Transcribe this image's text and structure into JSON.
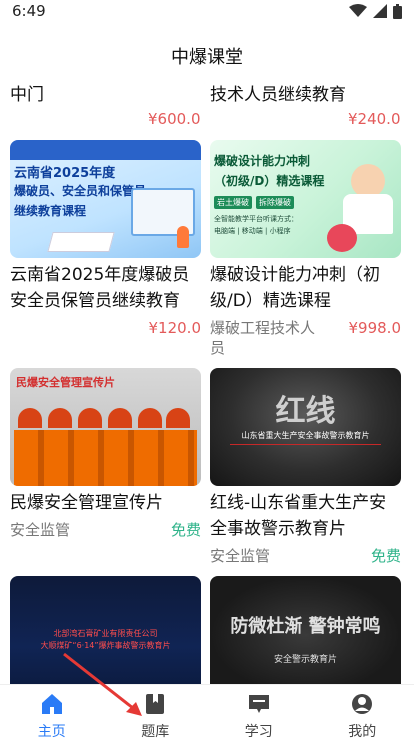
{
  "status": {
    "time": "6:49"
  },
  "header": {
    "title": "中爆课堂"
  },
  "partial_row": [
    {
      "title_fragment": "中门",
      "price": "¥600.0"
    },
    {
      "title_fragment": "技术人员继续教育",
      "price": "¥240.0"
    }
  ],
  "cards": [
    {
      "title": "云南省2025年度爆破员安全员保管员继续教育",
      "category": "",
      "price": "¥120.0",
      "thumb_text": [
        "云南省2025年度",
        "爆破员、安全员和保管员",
        "继续教育课程"
      ]
    },
    {
      "title": "爆破设计能力冲刺（初级/D）精选课程",
      "category": "爆破工程技术人员",
      "price": "¥998.0",
      "thumb_text": [
        "爆破设计能力冲刺",
        "（初级/D）精选课程",
        "岩土爆破",
        "拆除爆破",
        "全智能教学平台听课方式：",
        "电脑端 | 移动端 | 小程序"
      ]
    },
    {
      "title": "民爆安全管理宣传片",
      "category": "安全监管",
      "price": "免费",
      "thumb_text": [
        "民爆安全管理宣传片"
      ]
    },
    {
      "title": "红线-山东省重大生产安全事故警示教育片",
      "category": "安全监管",
      "price": "免费",
      "thumb_text": [
        "红线",
        "山东省重大生产安全事故警示教育片"
      ]
    },
    {
      "thumb_text": [
        "北部湾石膏矿业有限责任公司",
        "大顺煤矿“6·14”爆炸事故警示教育片"
      ]
    },
    {
      "thumb_text": [
        "防微杜渐 警钟常鸣",
        "安全警示教育片"
      ]
    }
  ],
  "tabs": [
    {
      "label": "主页",
      "icon": "home-icon",
      "active": true
    },
    {
      "label": "题库",
      "icon": "book-icon",
      "active": false
    },
    {
      "label": "学习",
      "icon": "chat-icon",
      "active": false
    },
    {
      "label": "我的",
      "icon": "profile-icon",
      "active": false
    }
  ],
  "colors": {
    "accent": "#2a7bf6",
    "price": "#e35a5a",
    "free": "#2fb38a"
  }
}
